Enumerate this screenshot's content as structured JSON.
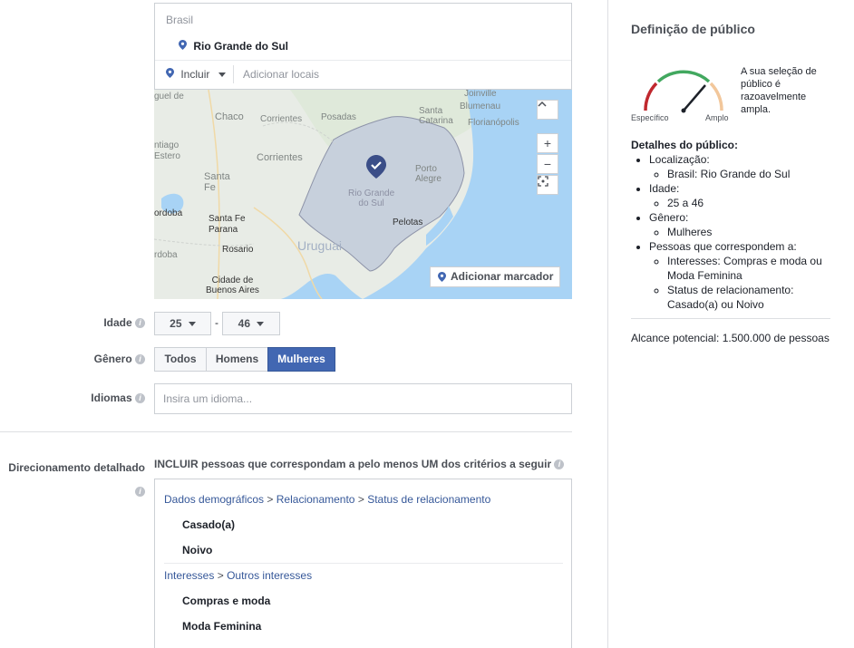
{
  "location": {
    "country": "Brasil",
    "region": "Rio Grande do Sul",
    "include_label": "Incluir",
    "add_placeholder": "Adicionar locais"
  },
  "map": {
    "labels": {
      "joinville": "Joinville",
      "blumenau": "Blumenau",
      "santa_catarina": "Santa\nCatarina",
      "florianopolis": "Florianópolis",
      "chaco": "Chaco",
      "corrientes1": "Corrientes",
      "posadas": "Posadas",
      "corrientes2": "Corrientes",
      "porto_alegre": "Porto\nAlegre",
      "rio_grande_do_sul": "Rio Grande\ndo Sul",
      "santa_fe": "Santa\nFe",
      "santa_fe_parana": "Santa Fe\nParana",
      "cordoba1": "ordoba",
      "pelotas": "Pelotas",
      "rosario": "Rosario",
      "uruguai": "Uruguai",
      "cordoba2": "rdoba",
      "cidade": "Cidade de\nBuenos Aires",
      "santiago": "ntiago\nEstero",
      "guel": "guel de"
    },
    "zoom_in": "+",
    "zoom_out": "−",
    "add_marker": "Adicionar marcador"
  },
  "age": {
    "label": "Idade",
    "min": "25",
    "dash": "-",
    "max": "46"
  },
  "gender": {
    "label": "Gênero",
    "options": [
      "Todos",
      "Homens",
      "Mulheres"
    ],
    "selected": "Mulheres"
  },
  "languages": {
    "label": "Idiomas",
    "placeholder": "Insira um idioma..."
  },
  "detailed": {
    "label": "Direcionamento detalhado",
    "prompt": "INCLUIR pessoas que correspondam a pelo menos UM dos critérios a seguir",
    "group1": {
      "crumb1": "Dados demográficos",
      "crumb2": "Relacionamento",
      "crumb3": "Status de relacionamento",
      "items": [
        "Casado(a)",
        "Noivo"
      ]
    },
    "group2": {
      "crumb1": "Interesses",
      "crumb2": "Outros interesses",
      "items": [
        "Compras e moda",
        "Moda Feminina"
      ]
    },
    "sep": ">"
  },
  "sidebar": {
    "title": "Definição de público",
    "gauge_specific": "Específico",
    "gauge_broad": "Amplo",
    "gauge_level": 0.78,
    "description": "A sua seleção de público é razoavelmente ampla.",
    "details_heading": "Detalhes do público:",
    "details": {
      "location_label": "Localização:",
      "location_value": "Brasil: Rio Grande do Sul",
      "age_label": "Idade:",
      "age_value": "25 a 46",
      "gender_label": "Gênero:",
      "gender_value": "Mulheres",
      "match_label": "Pessoas que correspondem a:",
      "match_interests": "Interesses: Compras e moda ou Moda Feminina",
      "match_status": "Status de relacionamento: Casado(a) ou Noivo"
    },
    "reach": "Alcance potencial: 1.500.000 de pessoas"
  },
  "colors": {
    "accent": "#4267b2",
    "link": "#365899",
    "water": "#a8d3f5",
    "region": "#c7d0dc"
  }
}
